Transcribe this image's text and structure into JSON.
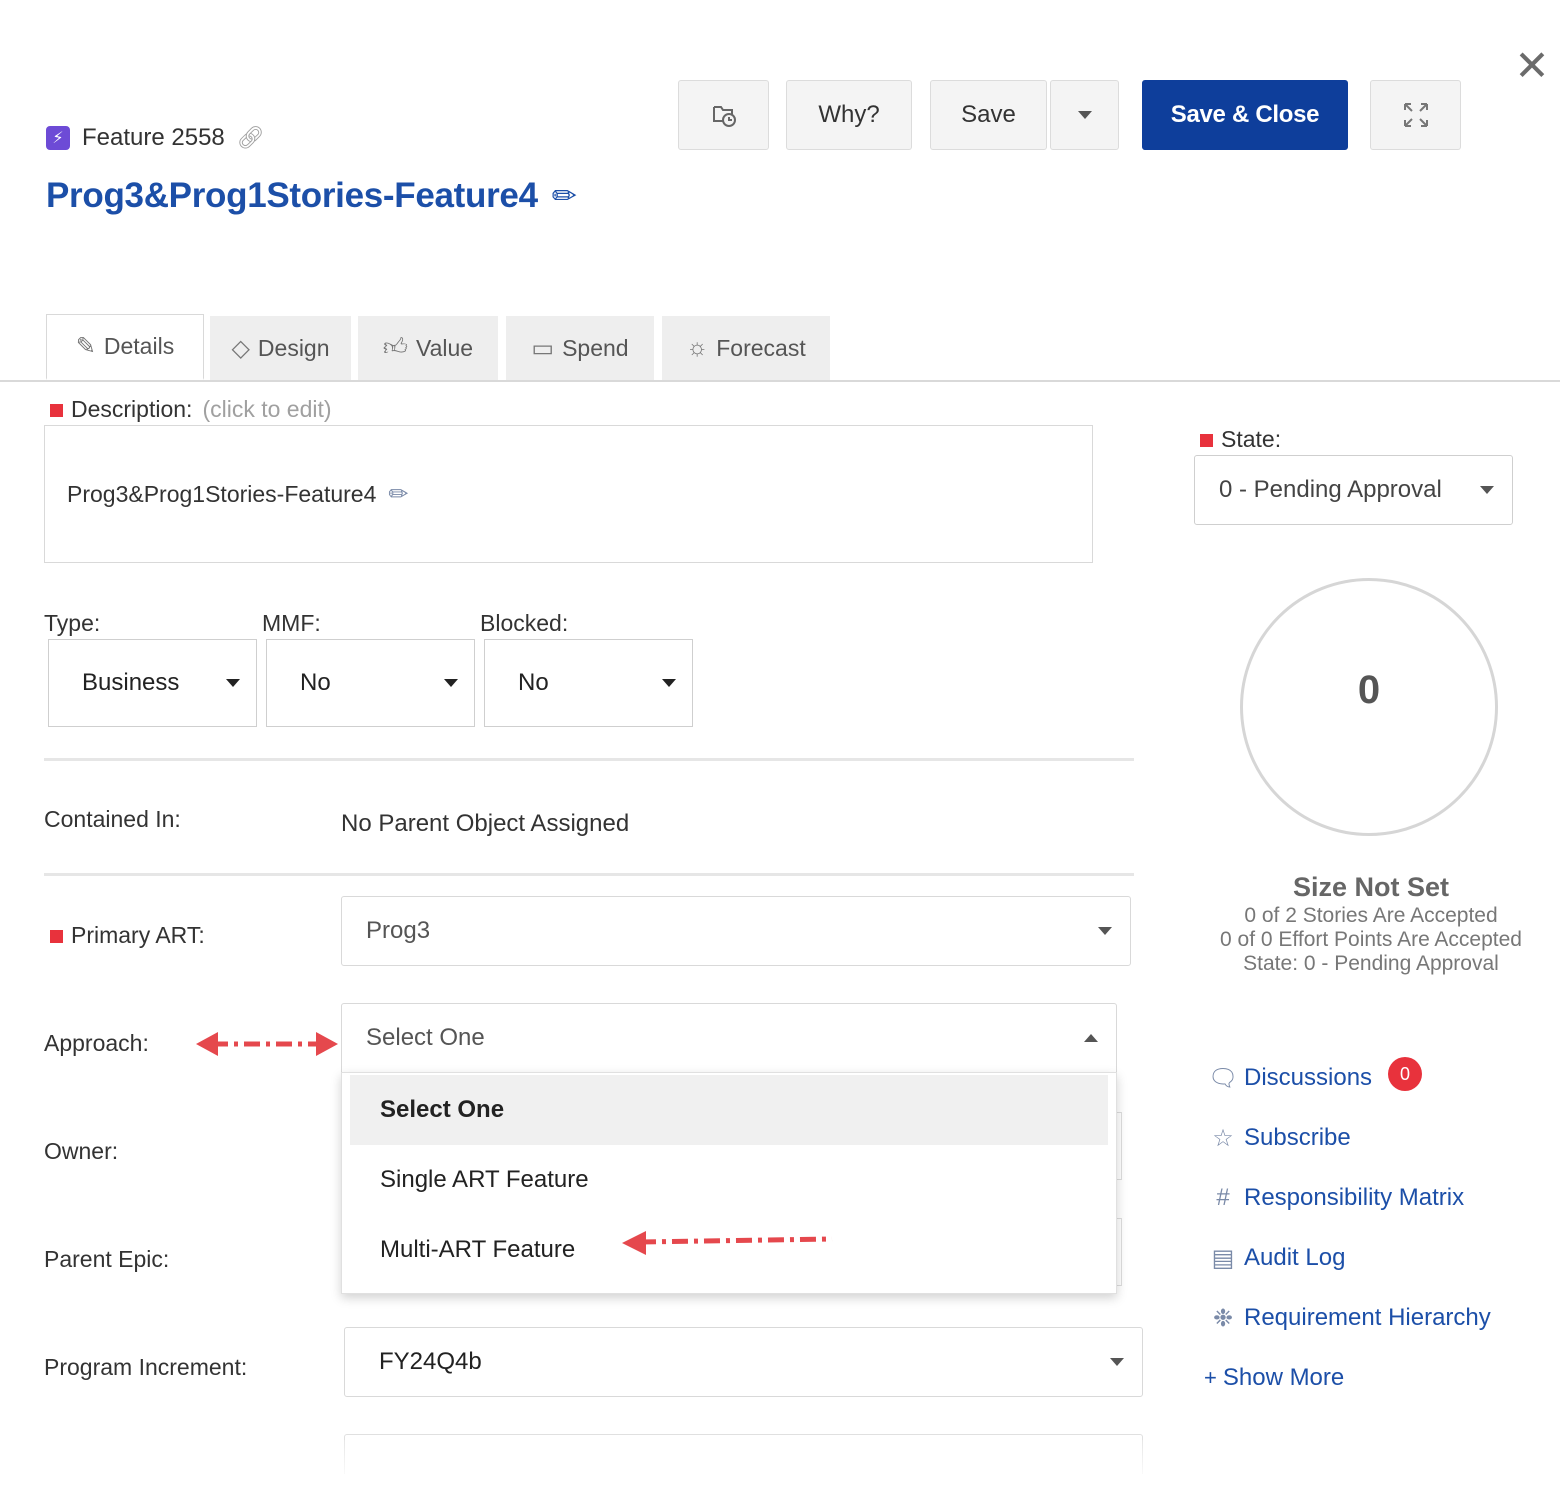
{
  "header": {
    "close_glyph": "✕",
    "item_type_id": "Feature 2558",
    "title": "Prog3&Prog1Stories-Feature4",
    "buttons": {
      "why": "Why?",
      "save": "Save",
      "save_close": "Save & Close"
    }
  },
  "tabs": [
    {
      "label": "Details",
      "icon": "pencil-icon",
      "active": true
    },
    {
      "label": "Design",
      "icon": "diamond-icon"
    },
    {
      "label": "Value",
      "icon": "thumbs-up-icon"
    },
    {
      "label": "Spend",
      "icon": "money-icon"
    },
    {
      "label": "Forecast",
      "icon": "sun-icon"
    }
  ],
  "details": {
    "description_label": "Description:",
    "description_hint": "(click to edit)",
    "description_value": "Prog3&Prog1Stories-Feature4",
    "type_label": "Type:",
    "type_value": "Business",
    "mmf_label": "MMF:",
    "mmf_value": "No",
    "blocked_label": "Blocked:",
    "blocked_value": "No",
    "contained_in_label": "Contained In:",
    "contained_in_value": "No Parent Object Assigned",
    "primary_art_label": "Primary ART:",
    "primary_art_value": "Prog3",
    "approach_label": "Approach:",
    "approach_value": "Select One",
    "approach_options": [
      "Select One",
      "Single ART Feature",
      "Multi-ART Feature"
    ],
    "owner_label": "Owner:",
    "parent_epic_label": "Parent Epic:",
    "program_increment_label": "Program Increment:",
    "program_increment_value": "FY24Q4b"
  },
  "side": {
    "state_label": "State:",
    "state_value": "0 - Pending Approval",
    "gauge_value": "0",
    "size_title": "Size Not Set",
    "stories_accepted": "0 of 2 Stories Are Accepted",
    "effort_accepted": "0 of 0 Effort Points Are Accepted",
    "state_summary": "State: 0 - Pending Approval",
    "links": {
      "discussions": "Discussions",
      "discussions_count": "0",
      "subscribe": "Subscribe",
      "responsibility_matrix": "Responsibility Matrix",
      "audit_log": "Audit Log",
      "requirement_hierarchy": "Requirement Hierarchy",
      "show_more": "Show More",
      "show_more_prefix": "+"
    }
  },
  "colors": {
    "primary": "#0e3e9b",
    "link": "#1c4fa8",
    "required": "#e8323c",
    "annotation_arrow": "#e5484d"
  }
}
